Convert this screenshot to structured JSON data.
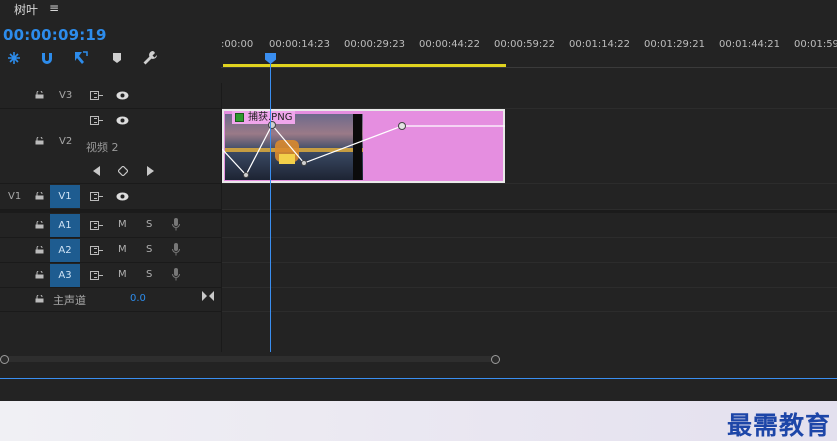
{
  "titlebar": {
    "title": "树叶",
    "menu_glyph": "≡"
  },
  "timeline": {
    "timecode": "00:00:09:19",
    "ruler_ticks": [
      ":00:00",
      "00:00:14:23",
      "00:00:29:23",
      "00:00:44:22",
      "00:00:59:22",
      "00:01:14:22",
      "00:01:29:21",
      "00:01:44:21",
      "00:01:59"
    ]
  },
  "tracks": {
    "v3": {
      "label": "V3"
    },
    "v2": {
      "label": "V2",
      "name": "视频 2"
    },
    "v1": {
      "source": "V1",
      "label": "V1"
    },
    "a1": {
      "label": "A1",
      "m": "M",
      "s": "S"
    },
    "a2": {
      "label": "A2",
      "m": "M",
      "s": "S"
    },
    "a3": {
      "label": "A3",
      "m": "M",
      "s": "S"
    },
    "master": {
      "label": "主声道",
      "value": "0.0"
    }
  },
  "clip": {
    "name": "捕获.PNG",
    "color": "#e58ee0"
  },
  "watermark": "最需教育",
  "colors": {
    "accent": "#2d8ceb",
    "workarea": "#e0d31f",
    "track_target": "#1e5c90"
  }
}
